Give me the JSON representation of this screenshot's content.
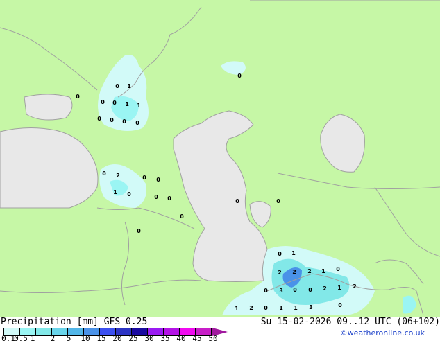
{
  "title": {
    "left": "Precipitation [mm]  GFS 0.25",
    "right": "Su 15-02-2026 09..12 UTC (06+102)"
  },
  "credit": "©weatheronline.co.uk",
  "colors": {
    "land": "#c6f7a6",
    "water": "#e8e8e8",
    "border": "#a0a0a0",
    "precip_light": "#d2fafa",
    "precip_mid": "#8ceced",
    "precip_heavy": "#5096e6"
  },
  "legend": {
    "ticks": [
      "0.1",
      "0.5",
      "1",
      "2",
      "5",
      "10",
      "15",
      "20",
      "25",
      "30",
      "35",
      "40",
      "45",
      "50"
    ],
    "colors": [
      "#d2faf8",
      "#9af5f3",
      "#82e8e8",
      "#69d4ea",
      "#52b6e8",
      "#4a92e8",
      "#3c50f0",
      "#2c34c4",
      "#1a0aa0",
      "#9a1af2",
      "#b412e6",
      "#f00af0",
      "#c81ec8"
    ],
    "arrow_color": "#a0189e"
  },
  "map": {
    "labels": [
      "0",
      "1",
      "0",
      "0",
      "1",
      "1",
      "0",
      "0",
      "0",
      "0",
      "0",
      "0",
      "2",
      "0",
      "0",
      "1",
      "0",
      "0",
      "0",
      "0",
      "0",
      "0",
      "0",
      "1",
      "2",
      "2",
      "2",
      "1",
      "0",
      "0",
      "3",
      "0",
      "0",
      "2",
      "1",
      "2",
      "1",
      "2",
      "0",
      "1",
      "1",
      "3",
      "0",
      "0",
      "0"
    ]
  }
}
